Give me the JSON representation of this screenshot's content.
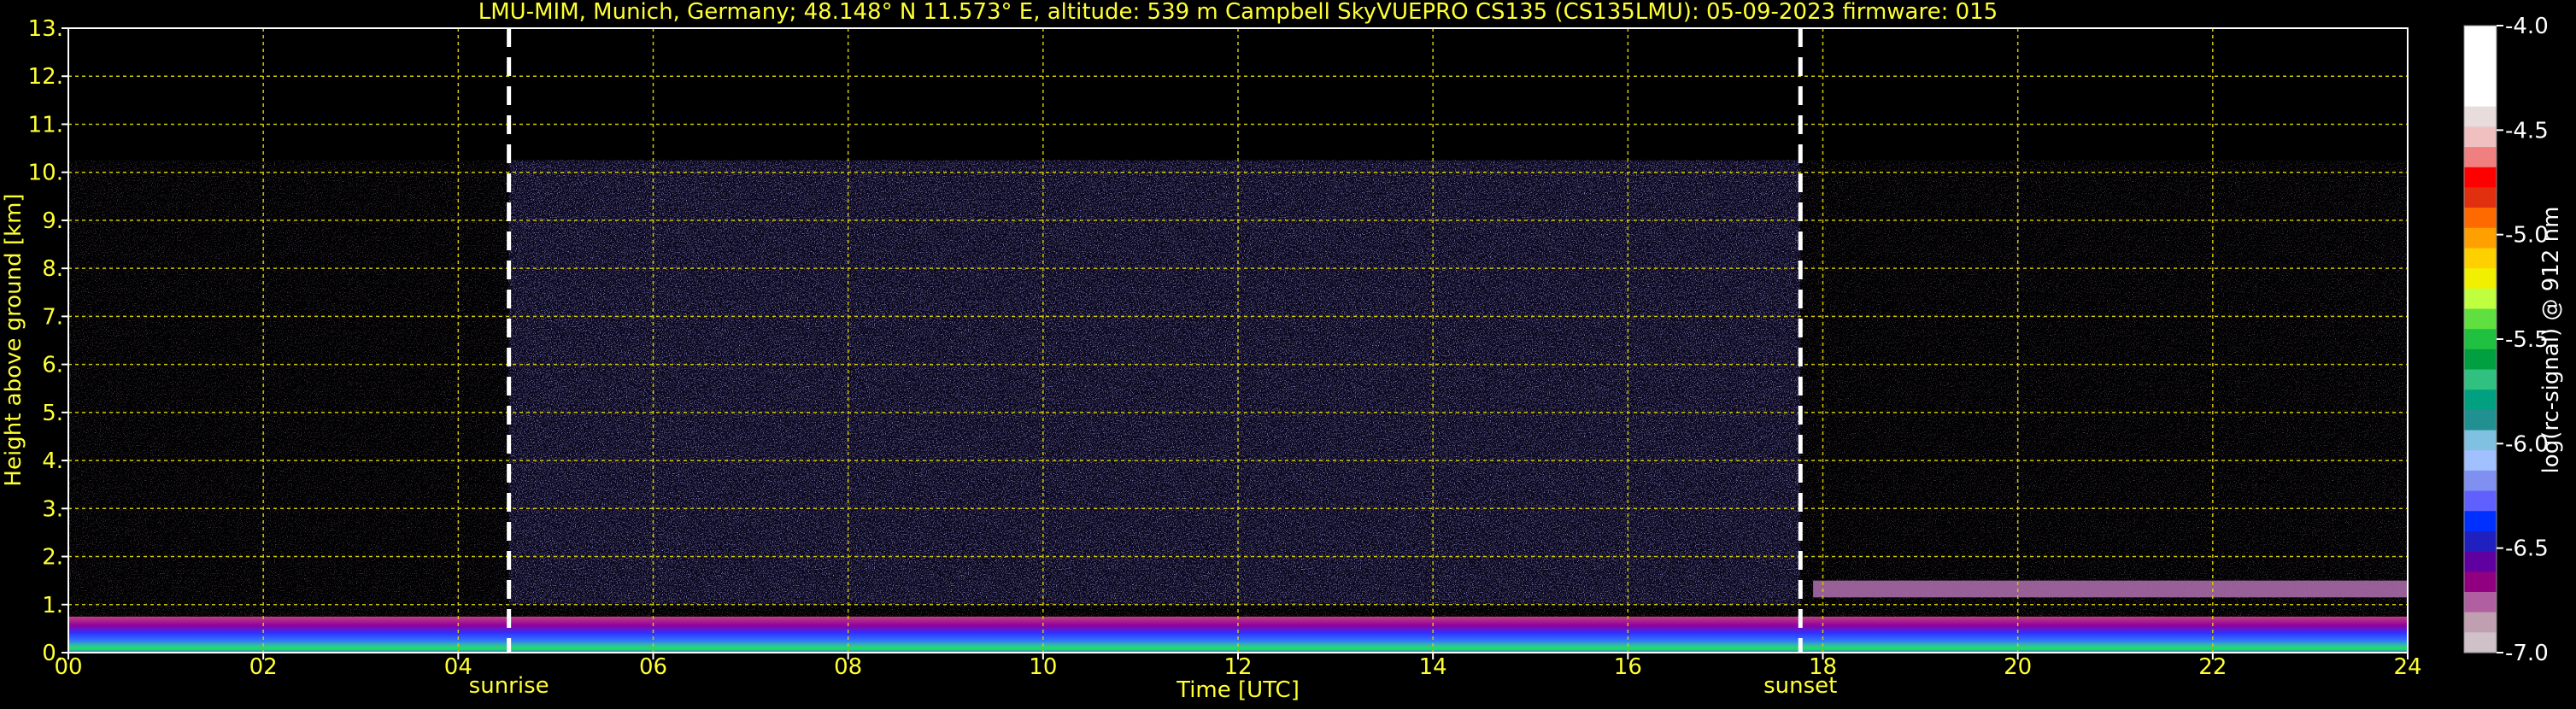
{
  "chart_data": [
    {
      "type": "heatmap",
      "title": "LMU-MIM, Munich, Germany; 48.148° N 11.573° E, altitude: 539 m    Campbell SkyVUEPRO CS135 (CS135LMU): 05-09-2023    firmware: 015",
      "xlabel": "Time [UTC]",
      "ylabel": "Height above ground [km]",
      "xlim": [
        0,
        24
      ],
      "ylim": [
        0,
        13
      ],
      "x_ticks": [
        "00",
        "02",
        "04",
        "06",
        "08",
        "10",
        "12",
        "14",
        "16",
        "18",
        "20",
        "22",
        "24"
      ],
      "y_ticks": [
        "0.",
        "1.",
        "2.",
        "3.",
        "4.",
        "5.",
        "6.",
        "7.",
        "8.",
        "9.",
        "10.",
        "11.",
        "12.",
        "13."
      ],
      "grid": true,
      "grid_color": "#d4c800",
      "background": "#000000",
      "text_color": "#ffff33",
      "annotations": [
        {
          "label": "sunrise",
          "x": 4.52
        },
        {
          "label": "sunset",
          "x": 17.77
        }
      ],
      "annotation_line_color": "#ffffff",
      "signal_top_km": 10.25,
      "layers": [
        {
          "name": "surface layer",
          "t_start": 0,
          "t_end": 24,
          "h_bottom": 0.0,
          "h_top": 0.75
        },
        {
          "name": "residual layer",
          "t_start": 17.9,
          "t_end": 24,
          "h_bottom": 1.15,
          "h_top": 1.5
        }
      ]
    },
    {
      "type": "colorbar",
      "label": "log(rc-signal) @ 912 nm",
      "range": [
        -7.0,
        -4.0
      ],
      "ticks": [
        "-4.0",
        "-4.5",
        "-5.0",
        "-5.5",
        "-6.0",
        "-6.5",
        "-7.0"
      ],
      "colors": [
        "#ffffff",
        "#ffffff",
        "#ffffff",
        "#ffffff",
        "#e8dcdc",
        "#f0c0c0",
        "#f08080",
        "#ff0000",
        "#e03010",
        "#ff6a00",
        "#ffa000",
        "#ffd000",
        "#f0f000",
        "#c0ff40",
        "#60e040",
        "#20c040",
        "#00a040",
        "#30c080",
        "#00a080",
        "#209090",
        "#80c0e0",
        "#a0c0ff",
        "#8090f0",
        "#6060ff",
        "#0030ff",
        "#2020c0",
        "#6000a0",
        "#900080",
        "#b060a0",
        "#c0a0b0",
        "#d0c0c8"
      ]
    }
  ]
}
